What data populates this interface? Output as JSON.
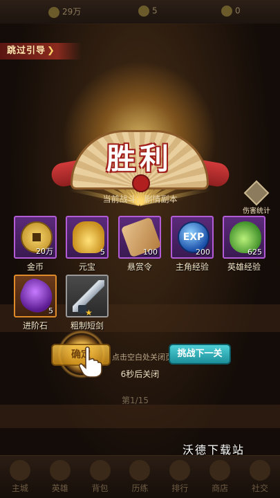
{
  "top_bar": {
    "resource_1": "29万",
    "resource_2": "5",
    "resource_3": "0"
  },
  "skip_guide": {
    "label": "跳过引导",
    "arrow": "❯"
  },
  "victory": {
    "title": "胜利"
  },
  "battle": {
    "current": "当前战斗：剧情副本"
  },
  "damage_stats": {
    "label": "伤害统计",
    "icon": "stats-icon"
  },
  "rewards": [
    {
      "name": "金币",
      "quantity": "20万",
      "icon": "coin-icon",
      "rarity": "purple"
    },
    {
      "name": "元宝",
      "quantity": "5",
      "icon": "gold-ingot-icon",
      "rarity": "purple"
    },
    {
      "name": "悬赏令",
      "quantity": "100",
      "icon": "scroll-icon",
      "rarity": "purple"
    },
    {
      "name": "主角经验",
      "quantity": "200",
      "icon": "exp-orb-icon",
      "orb_text": "EXP",
      "rarity": "purple"
    },
    {
      "name": "英雄经验",
      "quantity": "625",
      "icon": "potion-icon",
      "rarity": "purple"
    },
    {
      "name": "进阶石",
      "quantity": "5",
      "icon": "purple-stone-icon",
      "rarity": "orange"
    },
    {
      "name": "粗制短剑",
      "quantity": "",
      "icon": "short-sword-icon",
      "rarity": "grey",
      "stars": "★"
    }
  ],
  "buttons": {
    "confirm": "确定",
    "next_challenge": "挑战下一关"
  },
  "hint_partial": "点击空白处关闭页",
  "countdown": "6秒后关闭",
  "page_indicator": "第1/15",
  "bottom_nav": [
    "主城",
    "英雄",
    "背包",
    "历练",
    "排行",
    "商店",
    "社交"
  ],
  "watermark": "沃德下载站",
  "colors": {
    "purple_border": "#b45bd8",
    "orange_border": "#e08b2a",
    "next_button": "#2fb3bd",
    "confirm_button": "#f4c24a"
  }
}
